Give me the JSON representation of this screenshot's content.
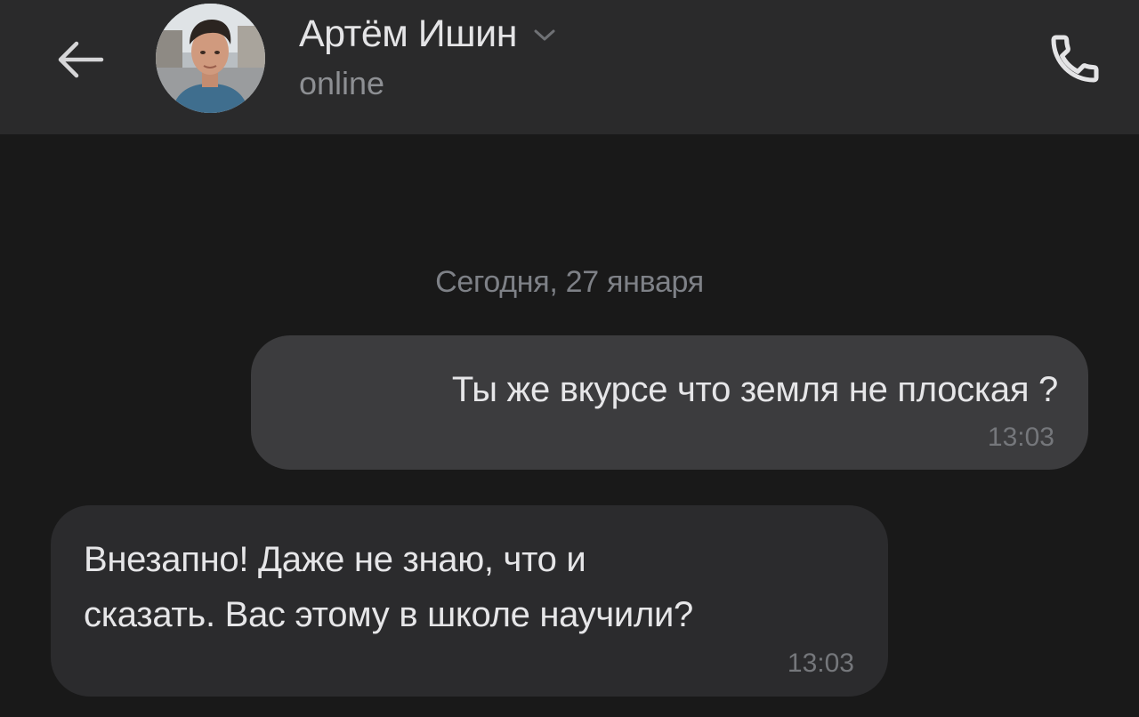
{
  "header": {
    "back_icon": "arrow-left-icon",
    "contact_name": "Артём Ишин",
    "status": "online",
    "dropdown_icon": "chevron-down-icon",
    "call_icon": "phone-icon"
  },
  "chat": {
    "date_separator": "Сегодня, 27 января",
    "messages": [
      {
        "direction": "outgoing",
        "text": "Ты же вкурсе что земля не плоская ?",
        "time": "13:03"
      },
      {
        "direction": "incoming",
        "text": "Внезапно! Даже не знаю, что и\nсказать. Вас этому в школе научили?",
        "time": "13:03"
      }
    ]
  },
  "colors": {
    "background": "#191919",
    "header": "#2a2a2b",
    "outgoing_bubble": "#3c3c3e",
    "incoming_bubble": "#2b2b2d",
    "text": "#e6e6e8",
    "muted_text": "#8d8f93"
  }
}
